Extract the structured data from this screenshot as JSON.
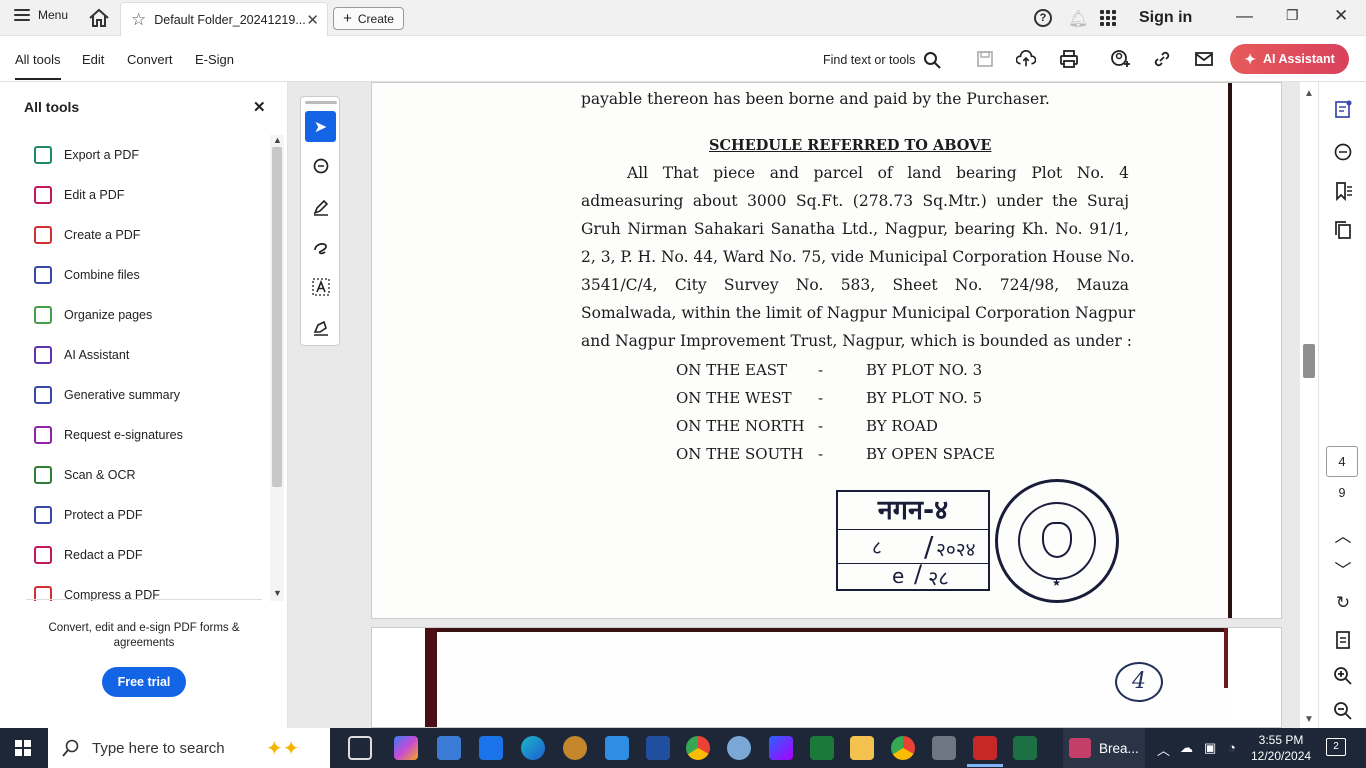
{
  "titlebar": {
    "menu_label": "Menu",
    "tab_title": "Default Folder_20241219...",
    "create_label": "Create",
    "sign_in": "Sign in"
  },
  "toolbar": {
    "tabs": [
      "All tools",
      "Edit",
      "Convert",
      "E-Sign"
    ],
    "find_label": "Find text or tools",
    "ai_label": "AI Assistant"
  },
  "left_panel": {
    "title": "All tools",
    "tools": [
      {
        "label": "Export a PDF",
        "color": "#1b8a6b"
      },
      {
        "label": "Edit a PDF",
        "color": "#c2185b"
      },
      {
        "label": "Create a PDF",
        "color": "#d32f2f"
      },
      {
        "label": "Combine files",
        "color": "#3949ab"
      },
      {
        "label": "Organize pages",
        "color": "#43a047"
      },
      {
        "label": "AI Assistant",
        "color": "#5e35b1"
      },
      {
        "label": "Generative summary",
        "color": "#3949ab"
      },
      {
        "label": "Request e-signatures",
        "color": "#8e24aa"
      },
      {
        "label": "Scan & OCR",
        "color": "#2e7d32"
      },
      {
        "label": "Protect a PDF",
        "color": "#3949ab"
      },
      {
        "label": "Redact a PDF",
        "color": "#c2185b"
      },
      {
        "label": "Compress a PDF",
        "color": "#d32f2f"
      }
    ],
    "promo": "Convert, edit and e-sign PDF forms & agreements",
    "trial_label": "Free trial"
  },
  "document": {
    "line_top": "payable thereon has been borne and paid by the Purchaser.",
    "schedule_heading": "SCHEDULE REFERRED TO ABOVE",
    "para": [
      "All That piece and parcel of land bearing Plot No. 4",
      "admeasuring about 3000 Sq.Ft. (278.73 Sq.Mtr.) under the Suraj",
      "Gruh Nirman Sahakari Sanatha Ltd., Nagpur, bearing Kh. No. 91/1,",
      "2, 3, P. H. No. 44, Ward No. 75, vide Municipal Corporation House No.",
      "3541/C/4, City Survey No. 583, Sheet No. 724/98, Mauza",
      "Somalwada, within the limit of Nagpur Municipal Corporation Nagpur",
      "and Nagpur Improvement Trust, Nagpur, which is bounded as under :"
    ],
    "boundaries": [
      {
        "side": "ON THE EAST",
        "sep": "-",
        "value": "BY PLOT NO. 3"
      },
      {
        "side": "ON THE WEST",
        "sep": "-",
        "value": "BY PLOT NO. 5"
      },
      {
        "side": "ON THE NORTH",
        "sep": "-",
        "value": "BY ROAD"
      },
      {
        "side": "ON THE SOUTH",
        "sep": "-",
        "value": "BY OPEN SPACE"
      }
    ],
    "stamp_row1": "नगन-४",
    "stamp_row2_a": "८",
    "stamp_row2_b": "२०२४",
    "stamp_row3_a": "e",
    "stamp_row3_b": "२८",
    "page2_number": "4"
  },
  "page_nav": {
    "current": "4",
    "total": "9"
  },
  "taskbar": {
    "search_placeholder": "Type here to search",
    "bread_label": "Brea...",
    "time": "3:55 PM",
    "date": "12/20/2024",
    "notifications": "2"
  }
}
